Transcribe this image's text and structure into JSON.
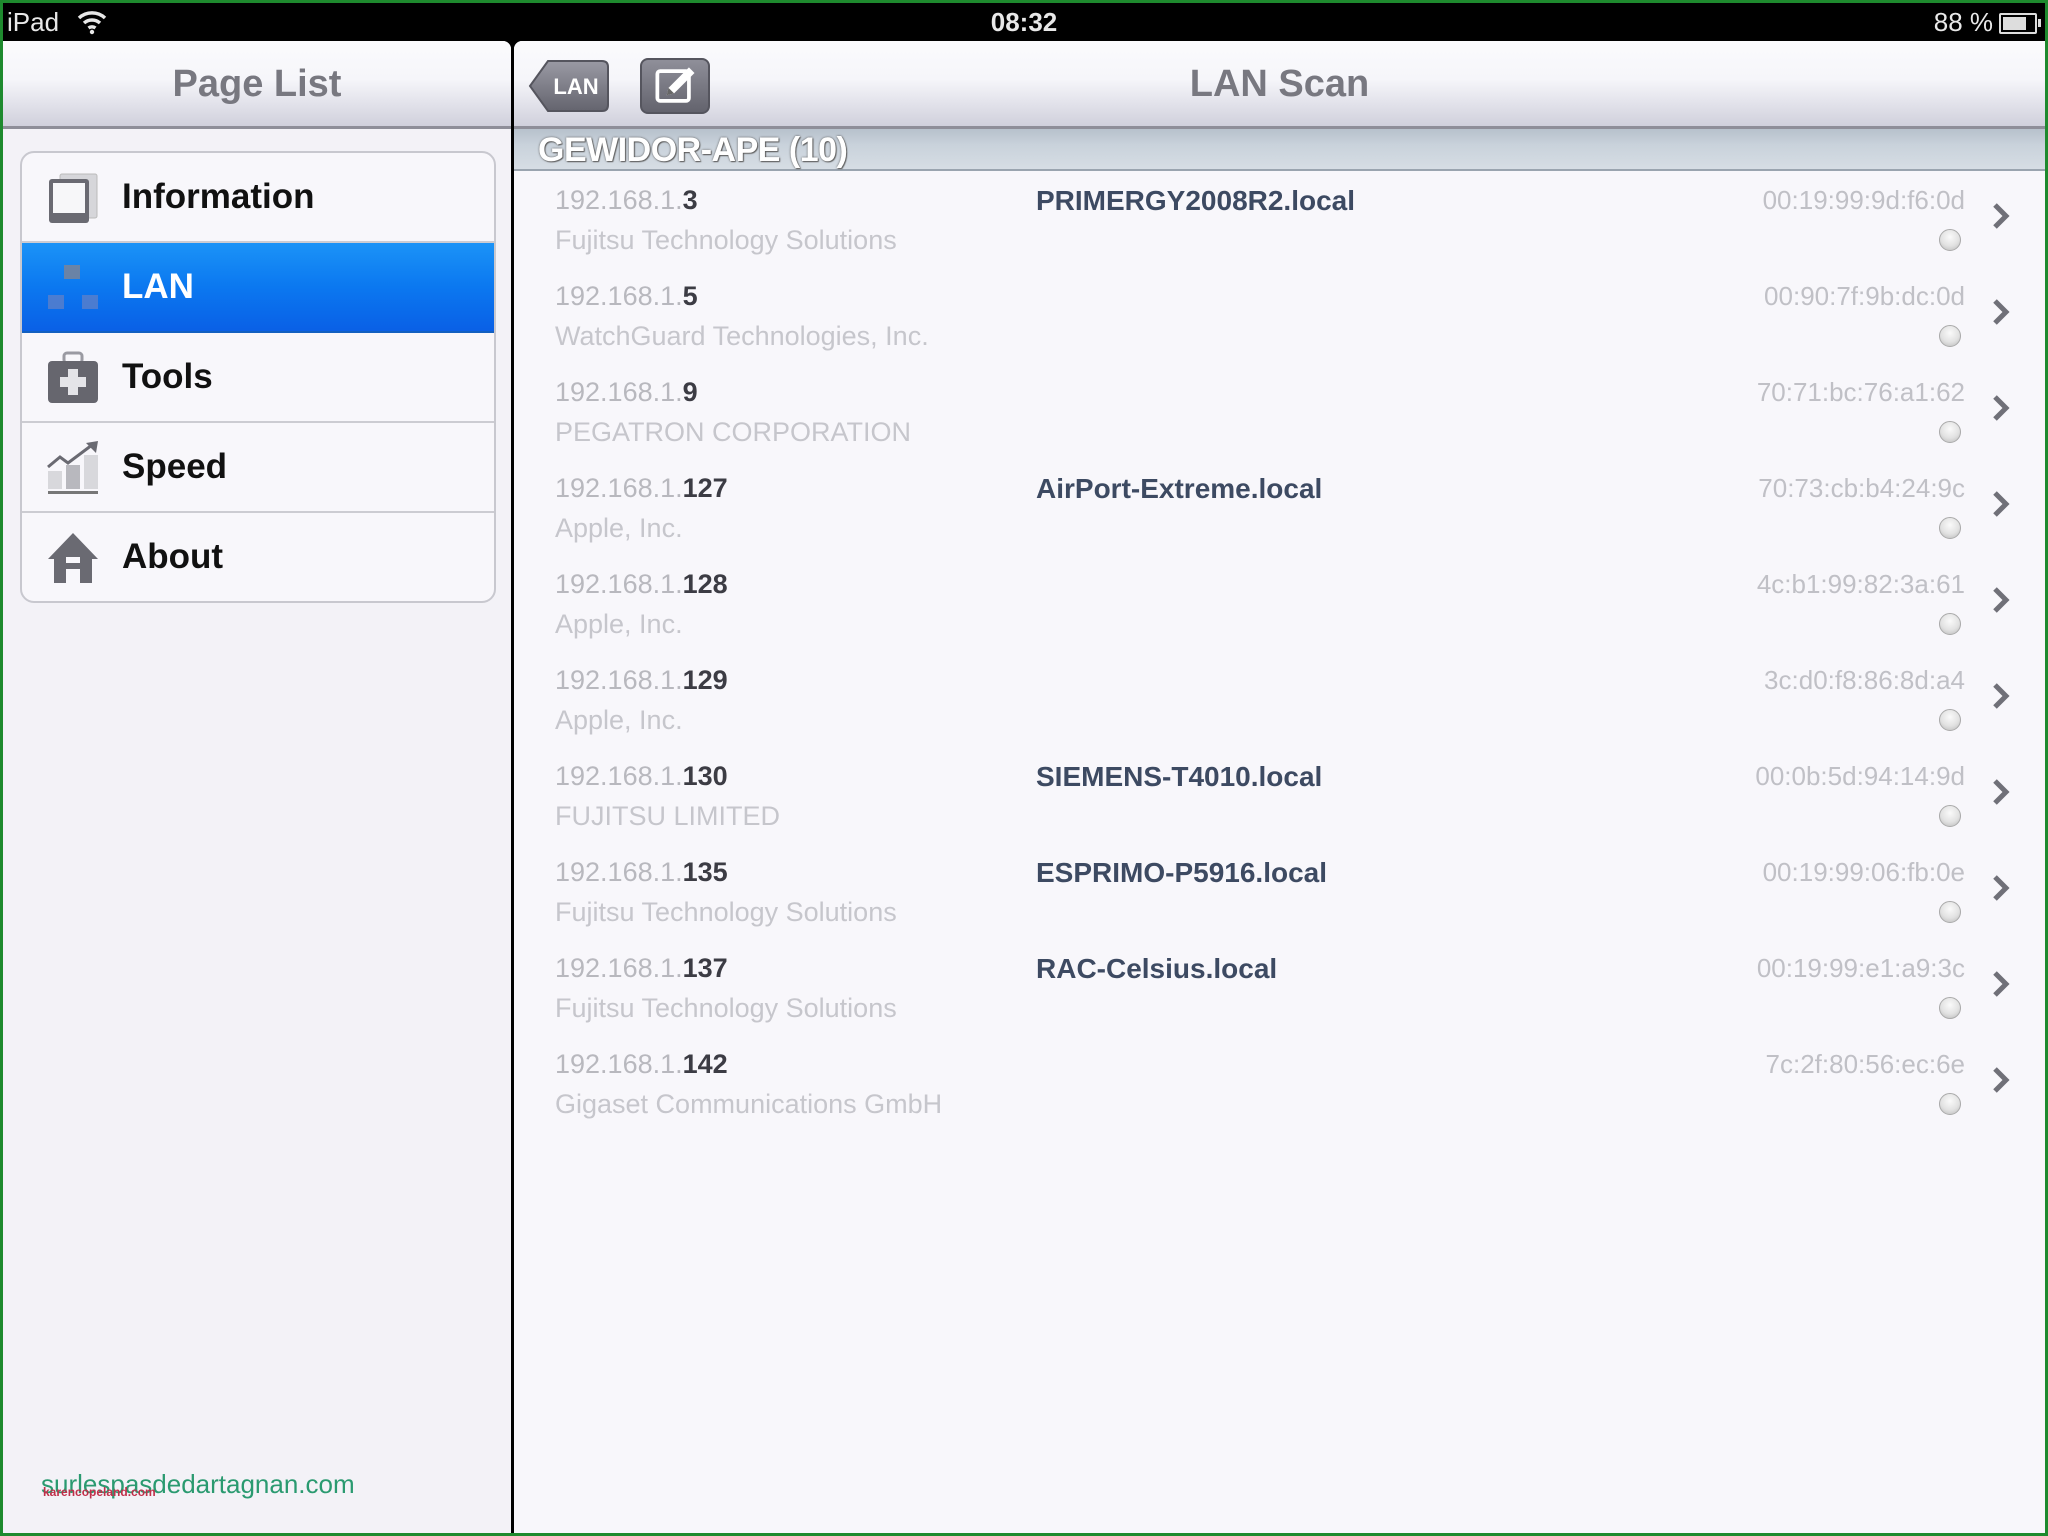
{
  "status_bar": {
    "carrier": "iPad",
    "time": "08:32",
    "battery_text": "88 %",
    "battery_level": 0.88
  },
  "sidebar": {
    "title": "Page List",
    "items": [
      {
        "label": "Information",
        "icon": "information-icon",
        "selected": false
      },
      {
        "label": "LAN",
        "icon": "lan-icon",
        "selected": true
      },
      {
        "label": "Tools",
        "icon": "toolbox-icon",
        "selected": false
      },
      {
        "label": "Speed",
        "icon": "speed-chart-icon",
        "selected": false
      },
      {
        "label": "About",
        "icon": "house-icon",
        "selected": false
      }
    ],
    "watermark": "surlespasdedartagnan.com",
    "watermark_small": "karencopeland.com"
  },
  "main": {
    "back_label": "LAN",
    "edit_icon": "edit-icon",
    "title": "LAN Scan",
    "section_title": "GEWIDOR-APE (10)",
    "devices": [
      {
        "ip_prefix": "192.168.1.",
        "ip_suffix": "3",
        "vendor": "Fujitsu Technology Solutions",
        "hostname": "PRIMERGY2008R2.local",
        "mac": "00:19:99:9d:f6:0d"
      },
      {
        "ip_prefix": "192.168.1.",
        "ip_suffix": "5",
        "vendor": "WatchGuard Technologies, Inc.",
        "hostname": "",
        "mac": "00:90:7f:9b:dc:0d"
      },
      {
        "ip_prefix": "192.168.1.",
        "ip_suffix": "9",
        "vendor": "PEGATRON CORPORATION",
        "hostname": "",
        "mac": "70:71:bc:76:a1:62"
      },
      {
        "ip_prefix": "192.168.1.",
        "ip_suffix": "127",
        "vendor": "Apple, Inc.",
        "hostname": "AirPort-Extreme.local",
        "mac": "70:73:cb:b4:24:9c"
      },
      {
        "ip_prefix": "192.168.1.",
        "ip_suffix": "128",
        "vendor": "Apple, Inc.",
        "hostname": "",
        "mac": "4c:b1:99:82:3a:61"
      },
      {
        "ip_prefix": "192.168.1.",
        "ip_suffix": "129",
        "vendor": "Apple, Inc.",
        "hostname": "",
        "mac": "3c:d0:f8:86:8d:a4"
      },
      {
        "ip_prefix": "192.168.1.",
        "ip_suffix": "130",
        "vendor": "FUJITSU LIMITED",
        "hostname": "SIEMENS-T4010.local",
        "mac": "00:0b:5d:94:14:9d"
      },
      {
        "ip_prefix": "192.168.1.",
        "ip_suffix": "135",
        "vendor": "Fujitsu Technology Solutions",
        "hostname": "ESPRIMO-P5916.local",
        "mac": "00:19:99:06:fb:0e"
      },
      {
        "ip_prefix": "192.168.1.",
        "ip_suffix": "137",
        "vendor": "Fujitsu Technology Solutions",
        "hostname": "RAC-Celsius.local",
        "mac": "00:19:99:e1:a9:3c"
      },
      {
        "ip_prefix": "192.168.1.",
        "ip_suffix": "142",
        "vendor": "Gigaset Communications GmbH",
        "hostname": "",
        "mac": "7c:2f:80:56:ec:6e"
      }
    ]
  },
  "colors": {
    "selected_accent": "#0b78f0",
    "hostname": "#3d4a62",
    "frame": "#1e8a2e"
  }
}
